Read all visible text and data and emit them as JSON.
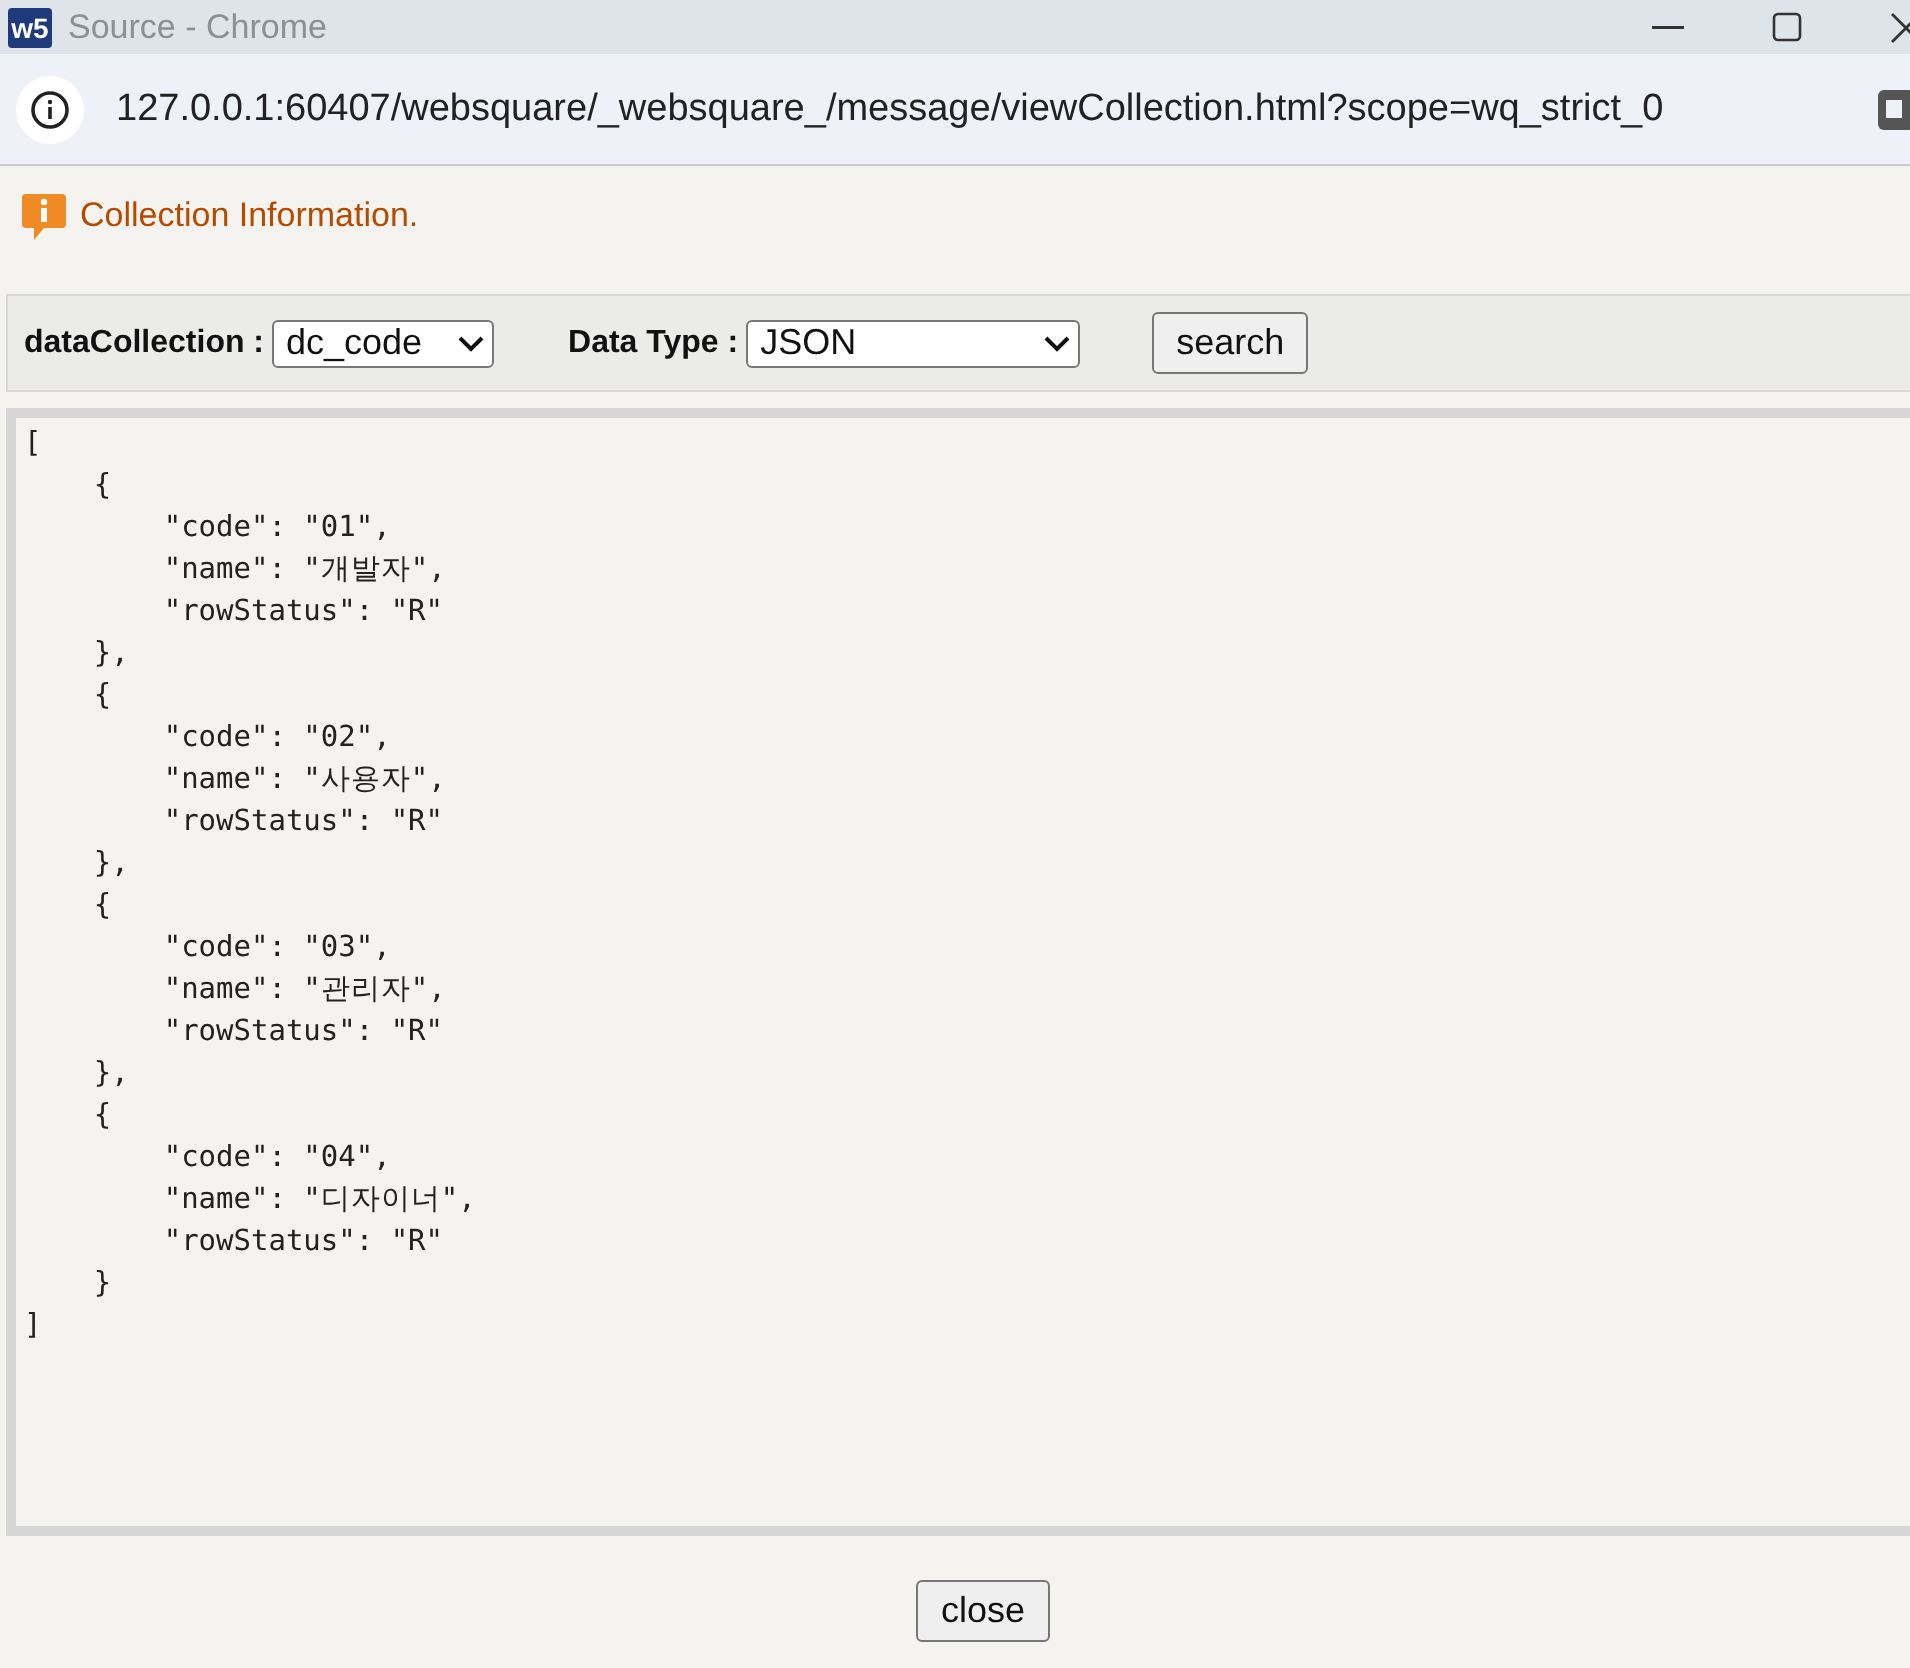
{
  "window": {
    "title": "Source - Chrome",
    "app_badge": "w5"
  },
  "address_bar": {
    "url": "127.0.0.1:60407/websquare/_websquare_/message/viewCollection.html?scope=wq_strict_0"
  },
  "info": {
    "message": "Collection Information."
  },
  "toolbar": {
    "data_collection": {
      "label": "dataCollection :",
      "value": "dc_code"
    },
    "data_type": {
      "label": "Data Type :",
      "value": "JSON"
    },
    "search_button": "search"
  },
  "output": {
    "text": "[\n    {\n        \"code\": \"01\",\n        \"name\": \"개발자\",\n        \"rowStatus\": \"R\"\n    },\n    {\n        \"code\": \"02\",\n        \"name\": \"사용자\",\n        \"rowStatus\": \"R\"\n    },\n    {\n        \"code\": \"03\",\n        \"name\": \"관리자\",\n        \"rowStatus\": \"R\"\n    },\n    {\n        \"code\": \"04\",\n        \"name\": \"디자이너\",\n        \"rowStatus\": \"R\"\n    }\n]"
  },
  "close_button": "close"
}
